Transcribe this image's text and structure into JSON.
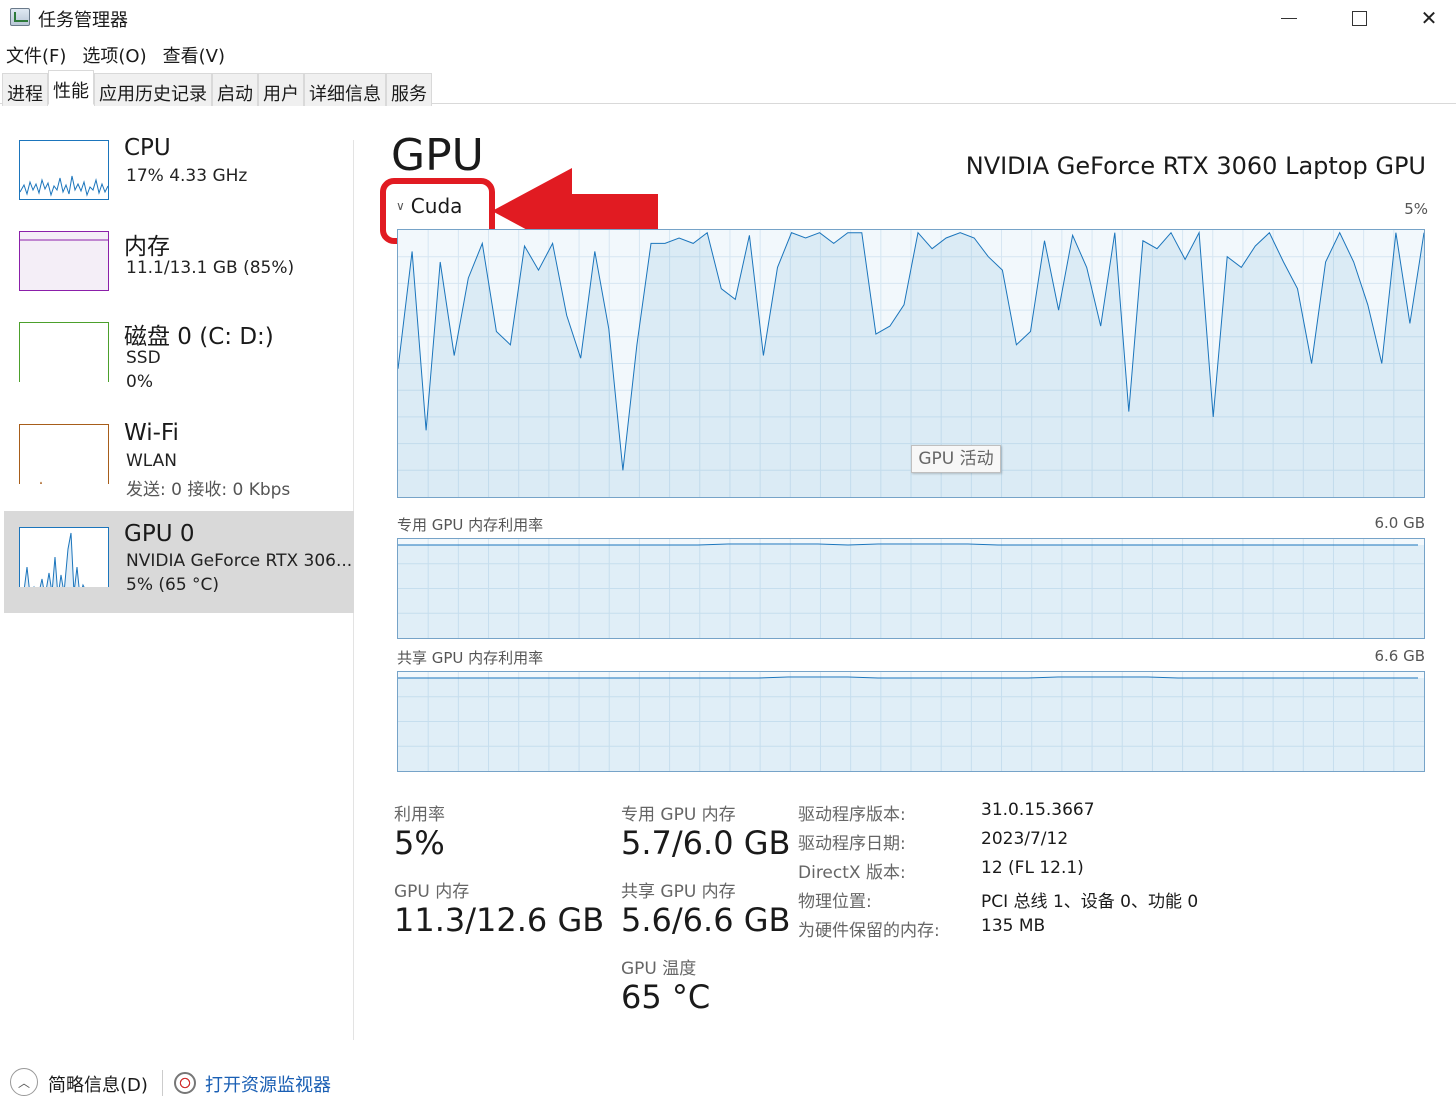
{
  "window": {
    "title": "任务管理器",
    "icon": "task-manager-icon",
    "controls": [
      "minimize",
      "maximize",
      "close"
    ]
  },
  "menu": [
    "文件(F)",
    "选项(O)",
    "查看(V)"
  ],
  "tabs": [
    {
      "label": "进程",
      "active": false
    },
    {
      "label": "性能",
      "active": true
    },
    {
      "label": "应用历史记录",
      "active": false
    },
    {
      "label": "启动",
      "active": false
    },
    {
      "label": "用户",
      "active": false
    },
    {
      "label": "详细信息",
      "active": false
    },
    {
      "label": "服务",
      "active": false
    }
  ],
  "sidebar": [
    {
      "name": "CPU",
      "line1": "17%  4.33 GHz",
      "line2": "",
      "color": "#1b75bc",
      "selected": false
    },
    {
      "name": "内存",
      "line1": "11.1/13.1 GB (85%)",
      "line2": "",
      "color": "#8b1fa9",
      "selected": false
    },
    {
      "name": "磁盘 0 (C: D:)",
      "line1": "SSD",
      "line2": "0%",
      "color": "#4ca02c",
      "selected": false
    },
    {
      "name": "Wi-Fi",
      "line1": "WLAN",
      "line2": "发送: 0 接收: 0 Kbps",
      "color": "#a75d1a",
      "selected": false
    },
    {
      "name": "GPU 0",
      "line1": "NVIDIA GeForce RTX 306...",
      "line2": "5% (65 °C)",
      "color": "#1b75bc",
      "selected": true
    }
  ],
  "main": {
    "title": "GPU",
    "model": "NVIDIA GeForce RTX 3060 Laptop GPU",
    "engine": "Cuda",
    "engine_max": "5%",
    "activity_tag": "GPU 活动",
    "dedicated_label": "专用 GPU 内存利用率",
    "dedicated_max": "6.0 GB",
    "shared_label": "共享 GPU 内存利用率",
    "shared_max": "6.6 GB"
  },
  "chart_data": {
    "type": "line",
    "series": [
      {
        "values": [
          48,
          92,
          25,
          88,
          53,
          82,
          95,
          62,
          57,
          94,
          85,
          95,
          68,
          52,
          92,
          63,
          10,
          57,
          95,
          95,
          97,
          95,
          99,
          78,
          74,
          98,
          53,
          86,
          99,
          97,
          99,
          95,
          99,
          99,
          61,
          64,
          72,
          99,
          93,
          97,
          99,
          97,
          90,
          85,
          57,
          62,
          96,
          70,
          98,
          86,
          64,
          99,
          32,
          96,
          93,
          99,
          89,
          99,
          30,
          90,
          86,
          94,
          99,
          88,
          78,
          50,
          88,
          99,
          88,
          72,
          50,
          99,
          65,
          99
        ]
      }
    ],
    "grid": true
  },
  "stats": {
    "utilization_label": "利用率",
    "utilization_value": "5%",
    "gpu_mem_label": "GPU 内存",
    "gpu_mem_value": "11.3/12.6 GB",
    "dedicated_mem_label": "专用 GPU 内存",
    "dedicated_mem_value": "5.7/6.0 GB",
    "shared_mem_label": "共享 GPU 内存",
    "shared_mem_value": "5.6/6.6 GB",
    "temp_label": "GPU 温度",
    "temp_value": "65 °C"
  },
  "info": [
    {
      "key": "驱动程序版本:",
      "value": "31.0.15.3667"
    },
    {
      "key": "驱动程序日期:",
      "value": "2023/7/12"
    },
    {
      "key": "DirectX 版本:",
      "value": "12 (FL 12.1)"
    },
    {
      "key": "物理位置:",
      "value": "PCI 总线 1、设备 0、功能 0"
    },
    {
      "key": "为硬件保留的内存:",
      "value": "135 MB"
    }
  ],
  "footer": {
    "summary_label": "简略信息(D)",
    "monitor_label": "打开资源监视器"
  }
}
